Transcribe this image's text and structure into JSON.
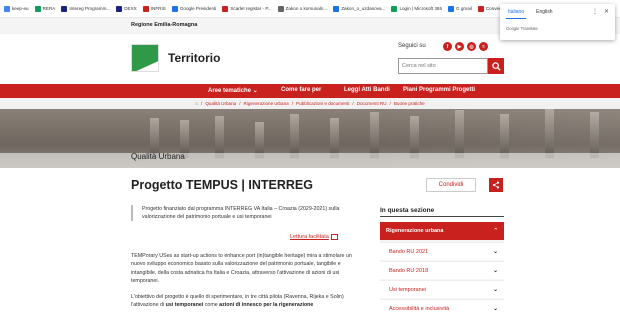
{
  "browser": {
    "bookmarks": [
      {
        "label": "keep-eu",
        "color": "#4285f4"
      },
      {
        "label": "RERA",
        "color": "#0f9d58"
      },
      {
        "label": "Intereg Programm...",
        "color": "#1a237e"
      },
      {
        "label": "DEXX",
        "color": "#1a237e"
      },
      {
        "label": "INFRIS",
        "color": "#c9211e"
      },
      {
        "label": "Google Presidenti",
        "color": "#1a73e8"
      },
      {
        "label": "Scarlet registar - P...",
        "color": "#c9211e"
      },
      {
        "label": "Zakon o komunaln...",
        "color": "#666666"
      },
      {
        "label": "Zakon_o_uzdanova...",
        "color": "#1a73e8"
      },
      {
        "label": "Login | Microsoft 365",
        "color": "#0f9d58"
      },
      {
        "label": "G gmail",
        "color": "#1a73e8"
      },
      {
        "label": "Convert PDF to Wo...",
        "color": "#c9211e"
      },
      {
        "label": "About",
        "color": "#333333"
      }
    ],
    "translate": {
      "tabs": [
        "Italiano",
        "English"
      ],
      "active_tab": "Italiano",
      "more_icon": "⋮",
      "close_icon": "✕",
      "footer": "Google Translate"
    }
  },
  "site": {
    "region": "Regione Emilia-Romagna",
    "title": "Territorio",
    "social_label": "Seguici su",
    "social": [
      {
        "name": "facebook",
        "glyph": "f"
      },
      {
        "name": "youtube",
        "glyph": "▶"
      },
      {
        "name": "instagram",
        "glyph": "◎"
      },
      {
        "name": "rss",
        "glyph": "≈"
      }
    ],
    "search_placeholder": "Cerca nel sito",
    "accent": "#c9211e",
    "brand_green": "#2e9a47"
  },
  "nav": {
    "items": [
      "Aree tematiche",
      "Come fare per",
      "Leggi Atti Bandi",
      "Piani Programmi Progetti"
    ]
  },
  "breadcrumb": {
    "items": [
      "Qualità Urbana",
      "Rigenerazione urbana",
      "Pubblicazioni e documenti",
      "Documenti RU",
      "Buone pratiche"
    ]
  },
  "hero": {
    "title": "Qualità Urbana"
  },
  "main": {
    "title": "Progetto TEMPUS | INTERREG",
    "share_label": "Condividi",
    "summary": "Progetto finanziato dal programma INTERREG VA Italia – Croazia (2029-2021) sulla valorizzazione del patrimonio portuale e usi temporanei",
    "easy_read": "Lettura facilitata",
    "para1": "TEMPorary USes as start-up actions to enhance port (in)tangible heritage) mira a stimolare un nuovo sviluppo economico basato sulla valorizzazione del patrimonio portuale, tangibile e intangibile, della costa adriatica fra Italia e Croazia, attraverso l'attivazione di azioni di usi temporanei.",
    "para2_pre": "L'obiettivo del progetto è quello di sperimentare, in tre città pilota (Ravenna, Rijeka e Solin) l'attivazione di ",
    "para2_b1": "usi temporanei",
    "para2_mid": " come ",
    "para2_b2": "azioni di innesco per la rigenerazione"
  },
  "sidebar": {
    "title": "In questa sezione",
    "head": "Rigenerazione urbana",
    "items": [
      "Bando RU 2021",
      "Bando RU 2018",
      "Usi temporanei",
      "Accessibilità e inclusività"
    ]
  }
}
